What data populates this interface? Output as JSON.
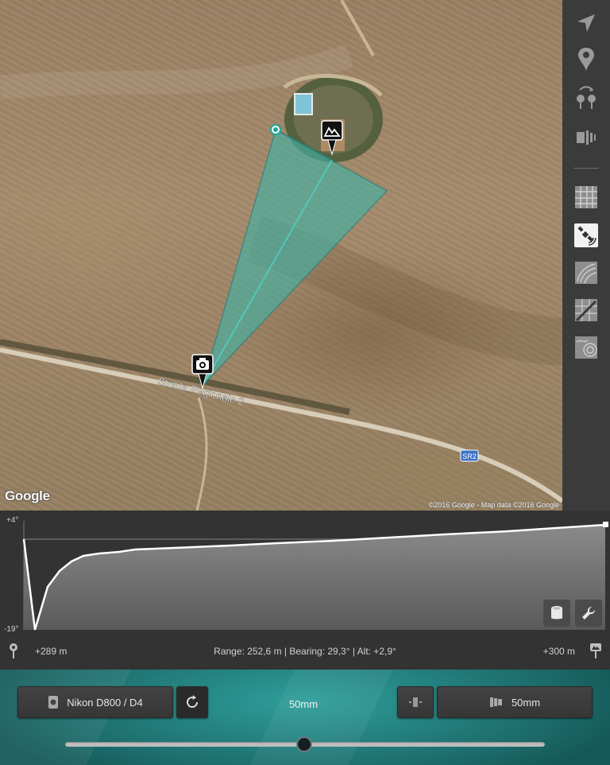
{
  "map": {
    "road_label": "Strada Regionale 2",
    "road_shield": "SR2",
    "logo": "Google",
    "credit": "©2016 Google - Map data ©2016 Google",
    "overlay_color": "#3fb3a8"
  },
  "toolbar": {
    "tools": [
      {
        "name": "locate",
        "icon": "navigation-arrow-icon"
      },
      {
        "name": "pin",
        "icon": "location-pin-icon"
      },
      {
        "name": "swap-pins",
        "icon": "swap-pins-icon"
      },
      {
        "name": "camera-sensor",
        "icon": "camera-sensor-icon"
      },
      {
        "name": "map-type-road",
        "icon": "grid-map-icon"
      },
      {
        "name": "map-type-satellite",
        "icon": "satellite-icon",
        "active": true
      },
      {
        "name": "map-type-terrain",
        "icon": "terrain-icon"
      },
      {
        "name": "map-type-hybrid",
        "icon": "hybrid-map-icon"
      },
      {
        "name": "map-type-topo",
        "icon": "topo-map-icon"
      }
    ]
  },
  "elevation": {
    "max_label": "+4°",
    "min_label": "-19°",
    "left_distance": "+289 m",
    "right_distance": "+300 m",
    "info": "Range: 252,6 m | Bearing: 29,3° | Alt: +2,9°"
  },
  "controls": {
    "camera_label": "Nikon D800 / D4",
    "focal_center": "50mm",
    "lens_label": "50mm",
    "slider_value": 0.5
  }
}
